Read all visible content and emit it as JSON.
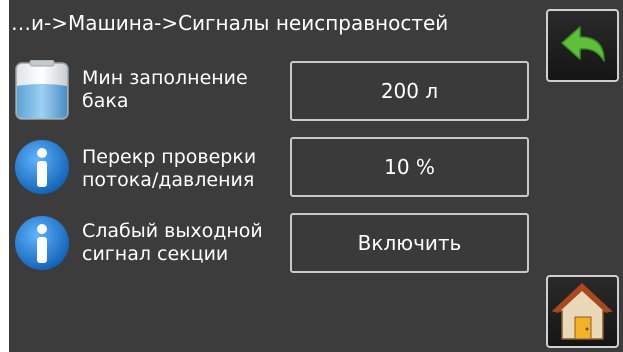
{
  "header": {
    "breadcrumb": "…и->Машина->Сигналы неисправностей"
  },
  "rows": [
    {
      "icon": "tank-level-icon",
      "label_line1": "Мин заполнение",
      "label_line2": "бака",
      "value": "200 л"
    },
    {
      "icon": "info-icon",
      "label_line1": "Перекр проверки",
      "label_line2": "потока/давления",
      "value": "10 %"
    },
    {
      "icon": "info-icon",
      "label_line1": "Слабый выходной",
      "label_line2": "сигнал секции",
      "value": "Включить"
    }
  ],
  "nav": {
    "back_icon": "back-arrow-icon",
    "home_icon": "home-icon"
  },
  "colors": {
    "background": "#3c3c3c",
    "text": "#ffffff",
    "button_border": "#c9c9c9",
    "back_arrow": "#5fbf3a",
    "info_blue": "#1a73c8"
  }
}
